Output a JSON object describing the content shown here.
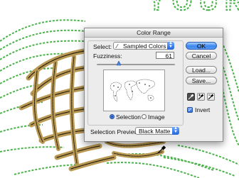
{
  "background": {
    "stripe_color": "#3fae3f",
    "outline_color": "#7a5a2a",
    "text": "YOUR"
  },
  "dialog": {
    "title": "Color Range",
    "select_label": "Select:",
    "select_value": "Sampled Colors",
    "fuzziness_label": "Fuzziness:",
    "fuzziness_value": "61",
    "radio_selection": "Selection",
    "radio_image": "Image",
    "selected_radio": "Selection",
    "preview_label": "Selection Preview:",
    "preview_value": "Black Matte",
    "buttons": {
      "ok": "OK",
      "cancel": "Cancel",
      "load": "Load...",
      "save": "Save..."
    },
    "invert_label": "Invert",
    "invert_checked": true,
    "eyedroppers": [
      "eyedropper-icon",
      "eyedropper-plus-icon",
      "eyedropper-minus-icon"
    ],
    "accent": "#3c86ee"
  }
}
